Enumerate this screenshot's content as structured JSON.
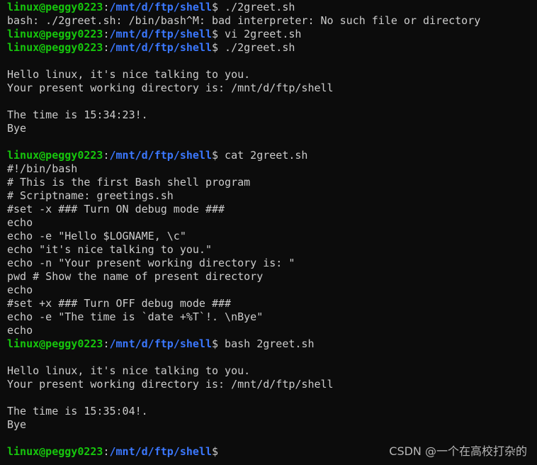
{
  "prompt": {
    "user_host": "linux@peggy0223",
    "colon": ":",
    "path": "/mnt/d/ftp/shell",
    "dollar": "$"
  },
  "lines": [
    {
      "type": "prompt",
      "cmd": " ./2greet.sh"
    },
    {
      "type": "output",
      "text": "bash: ./2greet.sh: /bin/bash^M: bad interpreter: No such file or directory"
    },
    {
      "type": "prompt",
      "cmd": " vi 2greet.sh"
    },
    {
      "type": "prompt",
      "cmd": " ./2greet.sh"
    },
    {
      "type": "output",
      "text": ""
    },
    {
      "type": "output",
      "text": "Hello linux, it's nice talking to you."
    },
    {
      "type": "output",
      "text": "Your present working directory is: /mnt/d/ftp/shell"
    },
    {
      "type": "output",
      "text": ""
    },
    {
      "type": "output",
      "text": "The time is 15:34:23!."
    },
    {
      "type": "output",
      "text": "Bye"
    },
    {
      "type": "output",
      "text": ""
    },
    {
      "type": "prompt",
      "cmd": " cat 2greet.sh"
    },
    {
      "type": "output",
      "text": "#!/bin/bash"
    },
    {
      "type": "output",
      "text": "# This is the first Bash shell program"
    },
    {
      "type": "output",
      "text": "# Scriptname: greetings.sh"
    },
    {
      "type": "output",
      "text": "#set -x ### Turn ON debug mode ###"
    },
    {
      "type": "output",
      "text": "echo"
    },
    {
      "type": "output",
      "text": "echo -e \"Hello $LOGNAME, \\c\""
    },
    {
      "type": "output",
      "text": "echo \"it's nice talking to you.\""
    },
    {
      "type": "output",
      "text": "echo -n \"Your present working directory is: \""
    },
    {
      "type": "output",
      "text": "pwd # Show the name of present directory"
    },
    {
      "type": "output",
      "text": "echo"
    },
    {
      "type": "output",
      "text": "#set +x ### Turn OFF debug mode ###"
    },
    {
      "type": "output",
      "text": "echo -e \"The time is `date +%T`!. \\nBye\""
    },
    {
      "type": "output",
      "text": "echo"
    },
    {
      "type": "prompt",
      "cmd": " bash 2greet.sh"
    },
    {
      "type": "output",
      "text": ""
    },
    {
      "type": "output",
      "text": "Hello linux, it's nice talking to you."
    },
    {
      "type": "output",
      "text": "Your present working directory is: /mnt/d/ftp/shell"
    },
    {
      "type": "output",
      "text": ""
    },
    {
      "type": "output",
      "text": "The time is 15:35:04!."
    },
    {
      "type": "output",
      "text": "Bye"
    },
    {
      "type": "output",
      "text": ""
    },
    {
      "type": "prompt",
      "cmd": ""
    }
  ],
  "watermark": "CSDN @一个在高校打杂的",
  "colors": {
    "background": "#0c0c0c",
    "user_host": "#16c60c",
    "path": "#3b78ff",
    "text": "#cccccc"
  }
}
